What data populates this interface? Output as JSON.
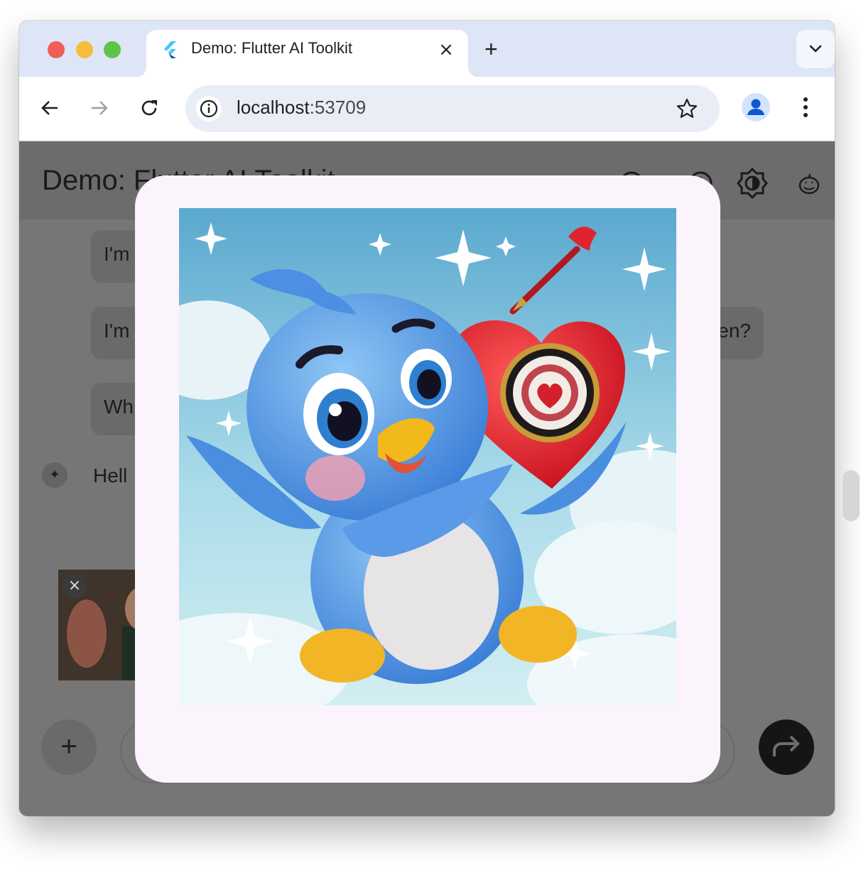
{
  "browser": {
    "tab_title": "Demo: Flutter AI Toolkit",
    "tab_close_icon": "×",
    "new_tab_icon": "+",
    "url_host": "localhost",
    "url_port": ":53709"
  },
  "app": {
    "title": "Demo: Flutter AI Toolkit",
    "icons": [
      "help-icon",
      "history-icon",
      "brightness-icon",
      "pumpkin-icon"
    ]
  },
  "chat": {
    "messages": [
      {
        "role": "user",
        "visible_text": "I'm"
      },
      {
        "role": "user",
        "visible_text": "I'm",
        "tail_text": "en?"
      },
      {
        "role": "user",
        "visible_text": "Wh"
      }
    ],
    "llm_message": {
      "visible_text": "Hell",
      "icon": "sparkle-icon"
    },
    "attachment": {
      "remove_icon": "×"
    },
    "add_button_icon": "+",
    "send_button_icon": "send-icon"
  },
  "dialog": {
    "image_subject": "blue-bird-holding-heart-dartboard"
  },
  "colors": {
    "tabstrip": "#dde5f7",
    "dialog_bg": "#fbf4fd",
    "scrim": "#767676",
    "send_button": "#151515"
  }
}
